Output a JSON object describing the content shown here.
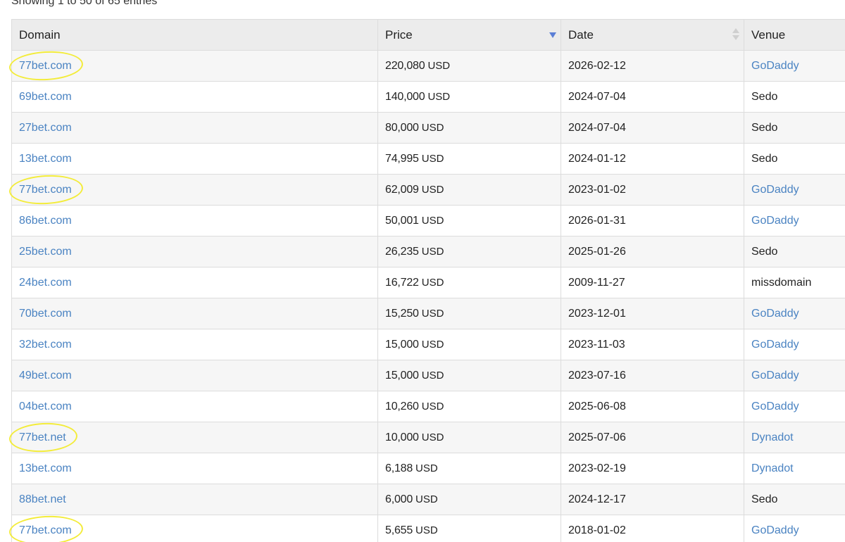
{
  "info_text": "Showing 1 to 50 of 65 entries",
  "columns": {
    "domain": "Domain",
    "price": "Price",
    "date": "Date",
    "venue": "Venue"
  },
  "sort": {
    "column": "price",
    "direction": "desc"
  },
  "highlight_color": "#f3ec3a",
  "link_color": "#4a83c2",
  "rows": [
    {
      "domain": "77bet.com",
      "price": "220,080",
      "currency": "USD",
      "date": "2026-02-12",
      "venue": "GoDaddy",
      "venue_link": true,
      "highlighted": true
    },
    {
      "domain": "69bet.com",
      "price": "140,000",
      "currency": "USD",
      "date": "2024-07-04",
      "venue": "Sedo",
      "venue_link": false,
      "highlighted": false
    },
    {
      "domain": "27bet.com",
      "price": "80,000",
      "currency": "USD",
      "date": "2024-07-04",
      "venue": "Sedo",
      "venue_link": false,
      "highlighted": false
    },
    {
      "domain": "13bet.com",
      "price": "74,995",
      "currency": "USD",
      "date": "2024-01-12",
      "venue": "Sedo",
      "venue_link": false,
      "highlighted": false
    },
    {
      "domain": "77bet.com",
      "price": "62,009",
      "currency": "USD",
      "date": "2023-01-02",
      "venue": "GoDaddy",
      "venue_link": true,
      "highlighted": true
    },
    {
      "domain": "86bet.com",
      "price": "50,001",
      "currency": "USD",
      "date": "2026-01-31",
      "venue": "GoDaddy",
      "venue_link": true,
      "highlighted": false
    },
    {
      "domain": "25bet.com",
      "price": "26,235",
      "currency": "USD",
      "date": "2025-01-26",
      "venue": "Sedo",
      "venue_link": false,
      "highlighted": false
    },
    {
      "domain": "24bet.com",
      "price": "16,722",
      "currency": "USD",
      "date": "2009-11-27",
      "venue": "missdomain",
      "venue_link": false,
      "highlighted": false
    },
    {
      "domain": "70bet.com",
      "price": "15,250",
      "currency": "USD",
      "date": "2023-12-01",
      "venue": "GoDaddy",
      "venue_link": true,
      "highlighted": false
    },
    {
      "domain": "32bet.com",
      "price": "15,000",
      "currency": "USD",
      "date": "2023-11-03",
      "venue": "GoDaddy",
      "venue_link": true,
      "highlighted": false
    },
    {
      "domain": "49bet.com",
      "price": "15,000",
      "currency": "USD",
      "date": "2023-07-16",
      "venue": "GoDaddy",
      "venue_link": true,
      "highlighted": false
    },
    {
      "domain": "04bet.com",
      "price": "10,260",
      "currency": "USD",
      "date": "2025-06-08",
      "venue": "GoDaddy",
      "venue_link": true,
      "highlighted": false
    },
    {
      "domain": "77bet.net",
      "price": "10,000",
      "currency": "USD",
      "date": "2025-07-06",
      "venue": "Dynadot",
      "venue_link": true,
      "highlighted": true
    },
    {
      "domain": "13bet.com",
      "price": "6,188",
      "currency": "USD",
      "date": "2023-02-19",
      "venue": "Dynadot",
      "venue_link": true,
      "highlighted": false
    },
    {
      "domain": "88bet.net",
      "price": "6,000",
      "currency": "USD",
      "date": "2024-12-17",
      "venue": "Sedo",
      "venue_link": false,
      "highlighted": false
    },
    {
      "domain": "77bet.com",
      "price": "5,655",
      "currency": "USD",
      "date": "2018-01-02",
      "venue": "GoDaddy",
      "venue_link": true,
      "highlighted": true
    }
  ]
}
